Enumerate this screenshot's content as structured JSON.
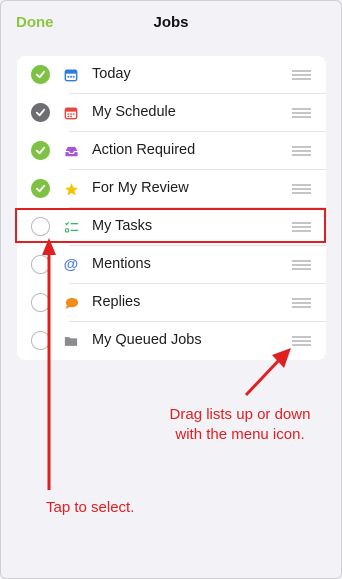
{
  "header": {
    "done_label": "Done",
    "title": "Jobs"
  },
  "colors": {
    "accent_green": "#8cc63f",
    "annotation_red": "#e02020"
  },
  "list": {
    "items": [
      {
        "label": "Today",
        "checked": true,
        "icon": "calendar-icon"
      },
      {
        "label": "My Schedule",
        "checked": true,
        "icon": "calendar-grid-icon"
      },
      {
        "label": "Action Required",
        "checked": true,
        "icon": "inbox-tray-icon"
      },
      {
        "label": "For My Review",
        "checked": true,
        "icon": "star-icon"
      },
      {
        "label": "My Tasks",
        "checked": false,
        "icon": "checklist-icon"
      },
      {
        "label": "Mentions",
        "checked": false,
        "icon": "at-sign-icon"
      },
      {
        "label": "Replies",
        "checked": false,
        "icon": "speech-bubble-icon"
      },
      {
        "label": "My Queued Jobs",
        "checked": false,
        "icon": "folder-icon"
      }
    ]
  },
  "annotations": {
    "drag_line1": "Drag lists up or down",
    "drag_line2": "with the menu icon.",
    "tap": "Tap to select."
  }
}
